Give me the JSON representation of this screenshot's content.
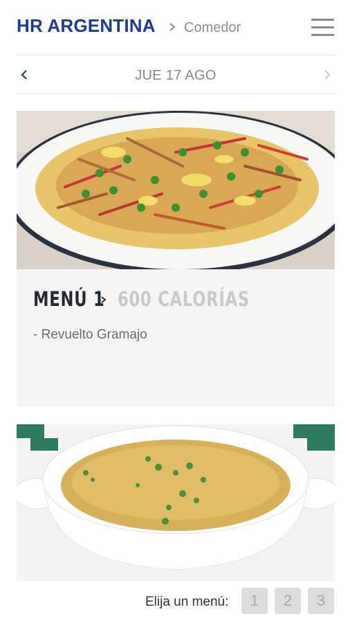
{
  "header": {
    "brand": "HR ARGENTINA",
    "section": "Comedor",
    "separator_icon": "chevron-right-icon",
    "menu_icon": "hamburger-icon"
  },
  "date_nav": {
    "label": "JUE 17 AGO",
    "prev_icon": "chevron-left-icon",
    "next_icon": "chevron-right-icon"
  },
  "menus": [
    {
      "title": "MENÚ 1",
      "calories": "600 CALORÍAS",
      "dishes": [
        "- Revuelto Gramajo"
      ],
      "image": "revuelto-gramajo-photo"
    },
    {
      "image": "soup-bowl-photo"
    }
  ],
  "picker": {
    "label": "Elija un menú:",
    "options": [
      "1",
      "2",
      "3"
    ]
  },
  "colors": {
    "brand": "#1d3c8f",
    "card_bg": "#f5f5f5",
    "muted": "#8d8d8d",
    "button_bg": "#dcdcdc"
  }
}
